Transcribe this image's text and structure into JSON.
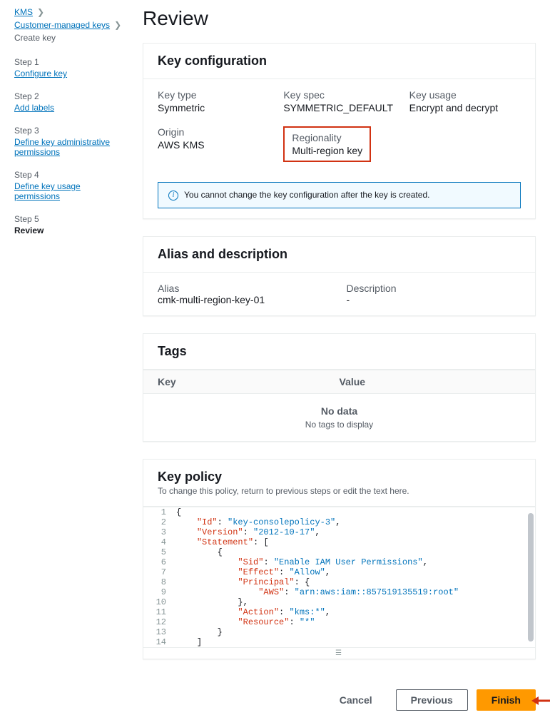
{
  "breadcrumb": {
    "kms": "KMS",
    "cmk": "Customer-managed keys",
    "current": "Create key"
  },
  "steps": {
    "s1n": "Step 1",
    "s1l": "Configure key",
    "s2n": "Step 2",
    "s2l": "Add labels",
    "s3n": "Step 3",
    "s3l": "Define key administrative permissions",
    "s4n": "Step 4",
    "s4l": "Define key usage permissions",
    "s5n": "Step 5",
    "s5l": "Review"
  },
  "page_title": "Review",
  "keyconf": {
    "heading": "Key configuration",
    "key_type_label": "Key type",
    "key_type": "Symmetric",
    "key_spec_label": "Key spec",
    "key_spec": "SYMMETRIC_DEFAULT",
    "key_usage_label": "Key usage",
    "key_usage": "Encrypt and decrypt",
    "origin_label": "Origin",
    "origin": "AWS KMS",
    "regionality_label": "Regionality",
    "regionality": "Multi-region key",
    "info": "You cannot change the key configuration after the key is created."
  },
  "aliasdesc": {
    "heading": "Alias and description",
    "alias_label": "Alias",
    "alias": "cmk-multi-region-key-01",
    "desc_label": "Description",
    "desc": "-"
  },
  "tags": {
    "heading": "Tags",
    "col_key": "Key",
    "col_value": "Value",
    "empty_title": "No data",
    "empty_sub": "No tags to display"
  },
  "policy": {
    "heading": "Key policy",
    "subtitle": "To change this policy, return to previous steps or edit the text here.",
    "lines": [
      "{",
      "    \"Id\": \"key-consolepolicy-3\",",
      "    \"Version\": \"2012-10-17\",",
      "    \"Statement\": [",
      "        {",
      "            \"Sid\": \"Enable IAM User Permissions\",",
      "            \"Effect\": \"Allow\",",
      "            \"Principal\": {",
      "                \"AWS\": \"arn:aws:iam::857519135519:root\"",
      "            },",
      "            \"Action\": \"kms:*\",",
      "            \"Resource\": \"*\"",
      "        }",
      "    ]"
    ]
  },
  "footer": {
    "cancel": "Cancel",
    "previous": "Previous",
    "finish": "Finish"
  }
}
